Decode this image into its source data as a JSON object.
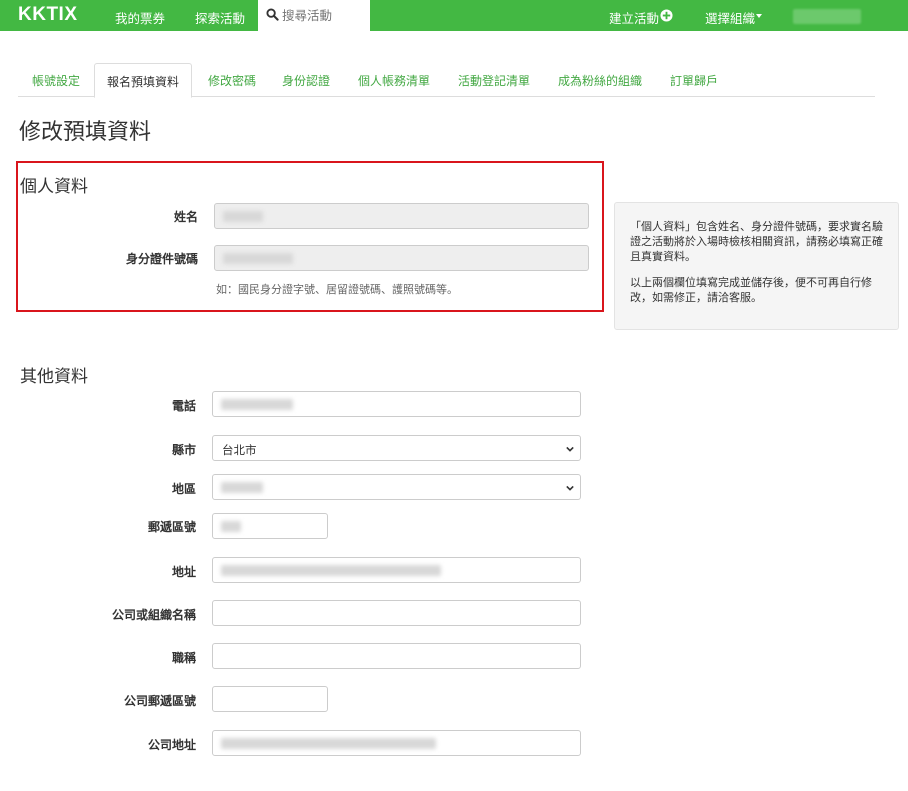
{
  "nav": {
    "logo": "KKTIX",
    "my_tickets": "我的票券",
    "explore": "探索活動",
    "search_placeholder": "搜尋活動",
    "create_event": "建立活動",
    "select_org": "選擇組織"
  },
  "tabs": [
    "帳號設定",
    "報名預填資料",
    "修改密碼",
    "身份認證",
    "個人帳務清單",
    "活動登記清單",
    "成為粉絲的組織",
    "訂單歸戶"
  ],
  "page_title": "修改預填資料",
  "personal": {
    "title": "個人資料",
    "name_label": "姓名",
    "id_label": "身分證件號碼",
    "id_help": "如：國民身分證字號、居留證號碼、護照號碼等。"
  },
  "info": {
    "p1": "「個人資料」包含姓名、身分證件號碼，要求實名驗證之活動將於入場時檢核相關資訊，請務必填寫正確且真實資料。",
    "p2": "以上兩個欄位填寫完成並儲存後，便不可再自行修改，如需修正，請洽客服。"
  },
  "other": {
    "title": "其他資料",
    "phone_label": "電話",
    "county_label": "縣市",
    "county_value": "台北市",
    "district_label": "地區",
    "zip_label": "郵遞區號",
    "address_label": "地址",
    "company_label": "公司或組織名稱",
    "job_title_label": "職稱",
    "company_zip_label": "公司郵遞區號",
    "company_address_label": "公司地址"
  },
  "colors": {
    "brand_green": "#43b843",
    "highlight_red": "#d9151c"
  }
}
